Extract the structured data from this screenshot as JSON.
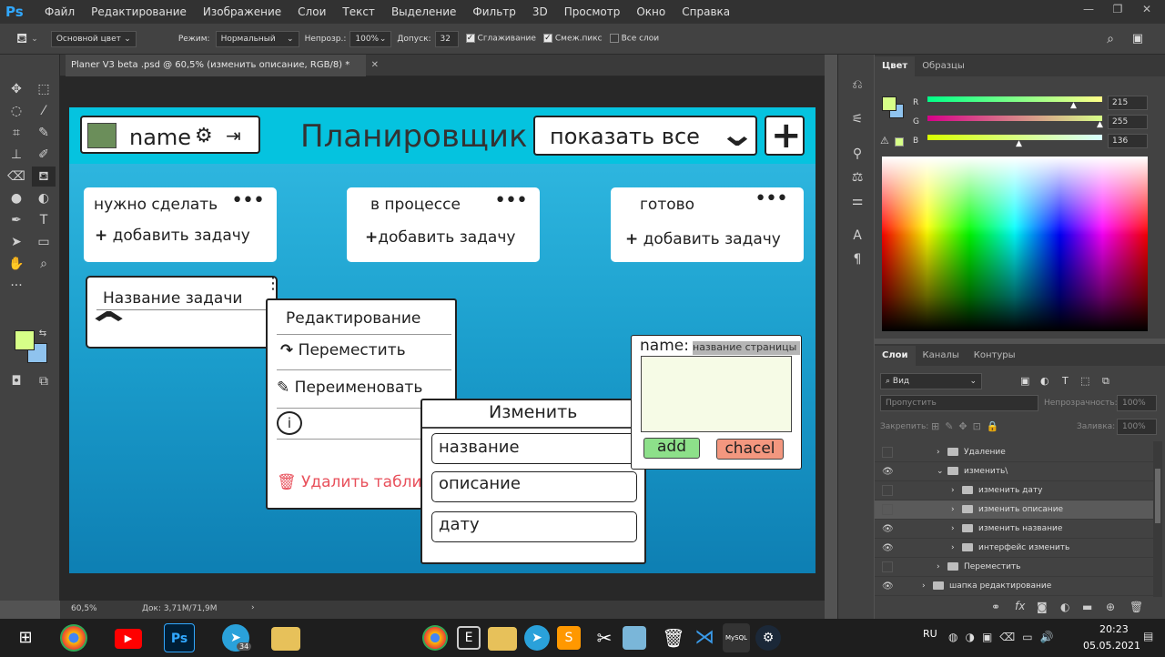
{
  "app": {
    "logo": "Ps"
  },
  "menu": [
    "Файл",
    "Редактирование",
    "Изображение",
    "Слои",
    "Текст",
    "Выделение",
    "Фильтр",
    "3D",
    "Просмотр",
    "Окно",
    "Справка"
  ],
  "options": {
    "foreground": "Основной цвет",
    "mode_label": "Режим:",
    "mode_value": "Нормальный",
    "opacity_label": "Непрозр.:",
    "opacity_value": "100%",
    "tolerance_label": "Допуск:",
    "tolerance_value": "32",
    "antialias": "Сглаживание",
    "contiguous": "Смеж.пикс",
    "all_layers": "Все слои"
  },
  "document": {
    "tab_title": "Planer V3 beta .psd @ 60,5% (изменить описание, RGB/8) *",
    "zoom": "60,5%",
    "doc_info": "Док: 3,71M/71,9M"
  },
  "design": {
    "user_name": "name",
    "title": "Планировщик",
    "filter_label": "показать все",
    "columns": [
      {
        "title": "нужно сделать",
        "add": "добавить задачу"
      },
      {
        "title": "в процессе",
        "add": "добавить задачу"
      },
      {
        "title": "готово",
        "add": "добавить задачу"
      }
    ],
    "task_title": "Название задачи",
    "context_menu": {
      "title": "Редактирование",
      "move": "Переместить",
      "rename": "Переименовать",
      "delete": "Удалить табли"
    },
    "change_menu": {
      "title": "Изменить",
      "items": [
        "название",
        "описание",
        "дату"
      ]
    },
    "page_dialog": {
      "name_label": "name:",
      "placeholder": "название страницы",
      "add": "add",
      "cancel": "chacel"
    }
  },
  "color_panel": {
    "tabs": [
      "Цвет",
      "Образцы"
    ],
    "channels": [
      {
        "label": "R",
        "value": "215",
        "level": 0.843
      },
      {
        "label": "G",
        "value": "255",
        "level": 1.0
      },
      {
        "label": "B",
        "value": "136",
        "level": 0.533
      }
    ],
    "foreground_color": "#d7ff88",
    "background_color": "#8fc3ee"
  },
  "layers_panel": {
    "tabs": [
      "Слои",
      "Каналы",
      "Контуры"
    ],
    "kind_filter": "Вид",
    "blend_mode": "Пропустить",
    "opacity_label": "Непрозрачность:",
    "opacity_value": "100%",
    "lock_label": "Закрепить:",
    "fill_label": "Заливка:",
    "fill_value": "100%",
    "layers": [
      {
        "name": "Удаление",
        "visible": false,
        "depth": 2,
        "open": false,
        "selected": false
      },
      {
        "name": "изменить\\",
        "visible": true,
        "depth": 2,
        "open": true,
        "selected": false
      },
      {
        "name": "изменить дату",
        "visible": false,
        "depth": 3,
        "open": false,
        "selected": false
      },
      {
        "name": "изменить описание",
        "visible": false,
        "depth": 3,
        "open": false,
        "selected": true
      },
      {
        "name": "изменить название",
        "visible": true,
        "depth": 3,
        "open": false,
        "selected": false
      },
      {
        "name": "интерфейс изменить",
        "visible": true,
        "depth": 3,
        "open": false,
        "selected": false
      },
      {
        "name": "Переместить",
        "visible": false,
        "depth": 2,
        "open": false,
        "selected": false
      },
      {
        "name": "шапка редактирование",
        "visible": true,
        "depth": 1,
        "open": false,
        "selected": false
      }
    ]
  },
  "taskbar": {
    "lang": "RU",
    "time": "20:23",
    "date": "05.05.2021",
    "telegram_badge": "34"
  }
}
